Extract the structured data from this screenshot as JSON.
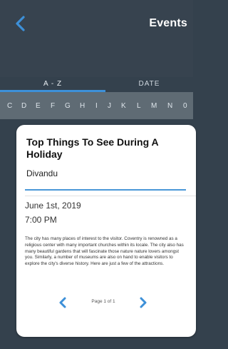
{
  "header": {
    "title": "Events",
    "back_icon": "chevron-left-icon"
  },
  "tabs": [
    {
      "label": "A - Z",
      "active": true
    },
    {
      "label": "DATE",
      "active": false
    }
  ],
  "letters": [
    "C",
    "D",
    "E",
    "F",
    "G",
    "H",
    "I",
    "J",
    "K",
    "L",
    "M",
    "N",
    "0"
  ],
  "event": {
    "title": "Top Things To See During A Holiday",
    "author": "Divandu",
    "date": "June 1st, 2019",
    "time": "7:00 PM",
    "body": "The city has many places of interest to the visitor. Coventry is renowned as a religious center with many important churches within its locale. The city also has many beautiful gardens that will fascinate those nature nature lovers amongst you. Similarly, a number of museums are also on hand to enable visitors to explore the city's diverse history. Here are just a few of the attractions.",
    "pager": "Page 1 of 1"
  },
  "colors": {
    "header_bg": "#37434f",
    "letter_bar": "#5f6b74",
    "accent": "#3d90d8"
  }
}
